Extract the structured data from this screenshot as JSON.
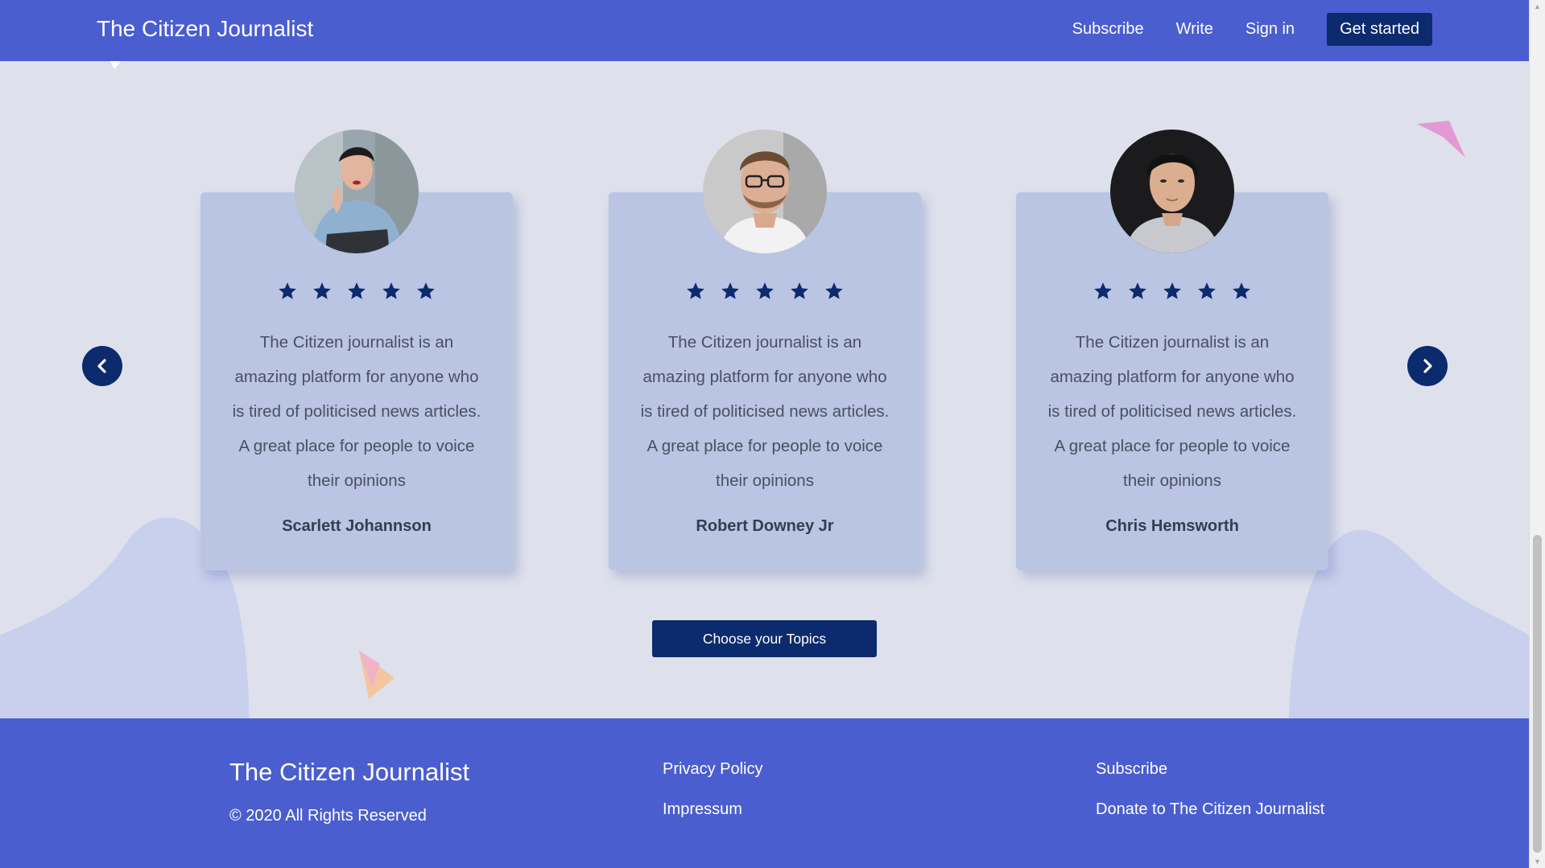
{
  "header": {
    "brand": "The Citizen Journalist",
    "nav": [
      {
        "label": "Subscribe"
      },
      {
        "label": "Write"
      },
      {
        "label": "Sign in"
      }
    ],
    "cta_label": "Get started"
  },
  "testimonials": {
    "cards": [
      {
        "rating": 5,
        "quote": "The Citizen journalist is an amazing platform for anyone who is tired of politicised news articles. A great place for people to voice their opinions",
        "author": "Scarlett Johannson"
      },
      {
        "rating": 5,
        "quote": "The Citizen journalist is an amazing platform for anyone who is tired of politicised news articles. A great place for people to voice their opinions",
        "author": "Robert Downey Jr"
      },
      {
        "rating": 5,
        "quote": "The Citizen journalist is an amazing platform for anyone who is tired of politicised news articles. A great place for people to voice their opinions",
        "author": "Chris Hemsworth"
      }
    ],
    "prev_icon": "chevron-left-icon",
    "next_icon": "chevron-right-icon",
    "topics_button": "Choose your Topics"
  },
  "footer": {
    "title": "The Citizen Journalist",
    "copyright": "© 2020 All Rights Reserved",
    "links_col1": [
      "Privacy Policy",
      "Impressum"
    ],
    "links_col2": [
      "Subscribe",
      "Donate to The Citizen Journalist"
    ]
  },
  "colors": {
    "primary": "#4a5ed0",
    "dark": "#0c2a6e",
    "card": "#bac5e3",
    "background": "#dee1ec"
  }
}
